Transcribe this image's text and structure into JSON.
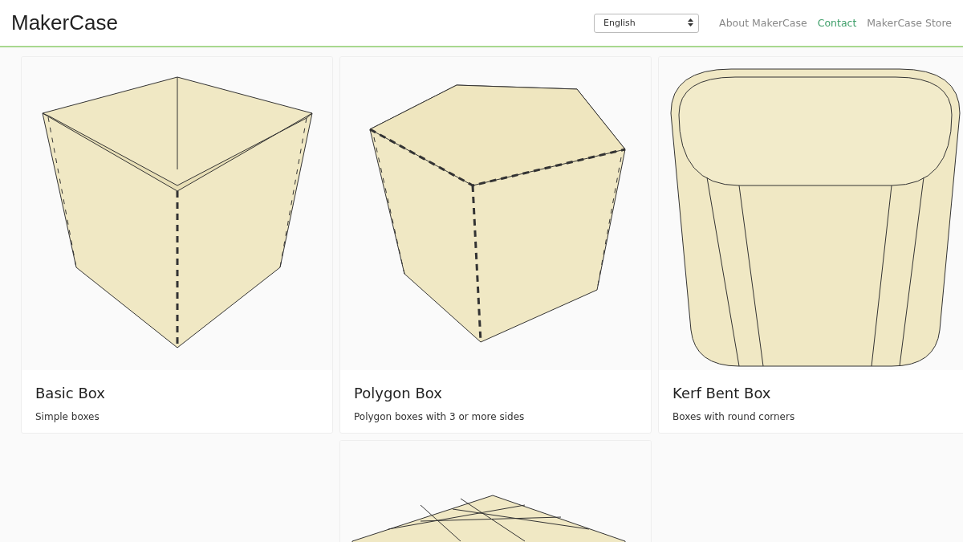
{
  "brand": "MakerCase",
  "language_select": {
    "value": "English"
  },
  "nav": [
    {
      "label": "About MakerCase",
      "selected": false
    },
    {
      "label": "Contact",
      "selected": true
    },
    {
      "label": "MakerCase Store",
      "selected": false
    }
  ],
  "cards": [
    {
      "kind": "basic",
      "title": "Basic Box",
      "description": "Simple boxes"
    },
    {
      "kind": "polygon",
      "title": "Polygon Box",
      "description": "Polygon boxes with 3 or more sides"
    },
    {
      "kind": "kerf",
      "title": "Kerf Bent Box",
      "description": "Boxes with round corners"
    },
    {
      "kind": "grid"
    }
  ]
}
